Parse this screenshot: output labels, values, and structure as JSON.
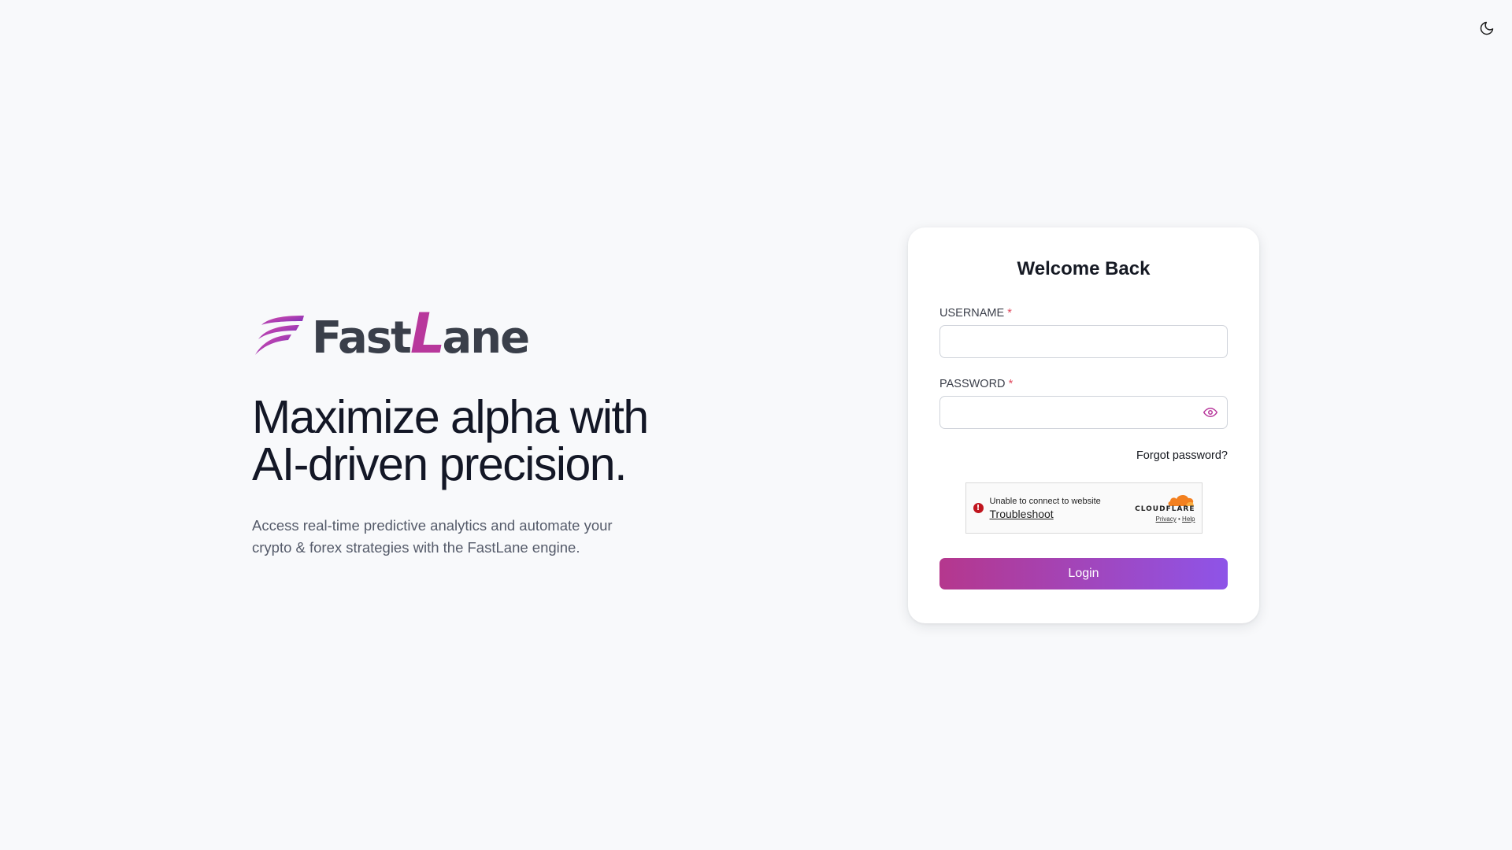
{
  "header": {
    "theme_toggle_icon": "moon-icon"
  },
  "brand": {
    "logo_icon": "wing-icon",
    "logo_text_prefix": "Fast",
    "logo_text_accent": "L",
    "logo_text_suffix": "ane",
    "accent_color": "#b8389c",
    "logo_text_color": "#3a3f4a"
  },
  "hero": {
    "headline_line1": "Maximize alpha with",
    "headline_line2": "AI-driven precision.",
    "subtext_line1": "Access real-time predictive analytics and automate your",
    "subtext_line2": "crypto & forex strategies with the FastLane engine."
  },
  "login": {
    "title": "Welcome Back",
    "username_label": "USERNAME",
    "username_value": "",
    "password_label": "PASSWORD",
    "password_value": "",
    "required_marker": "*",
    "password_toggle_icon": "eye-icon",
    "forgot_label": "Forgot password?",
    "submit_label": "Login",
    "button_gradient": [
      "#b5378d",
      "#8e54e8"
    ]
  },
  "captcha": {
    "error_icon": "error-icon",
    "message": "Unable to connect to website",
    "troubleshoot_label": "Troubleshoot",
    "brand_logo_icon": "cloud-icon",
    "brand_name": "CLOUDFLARE",
    "privacy_label": "Privacy",
    "separator": "•",
    "help_label": "Help"
  }
}
